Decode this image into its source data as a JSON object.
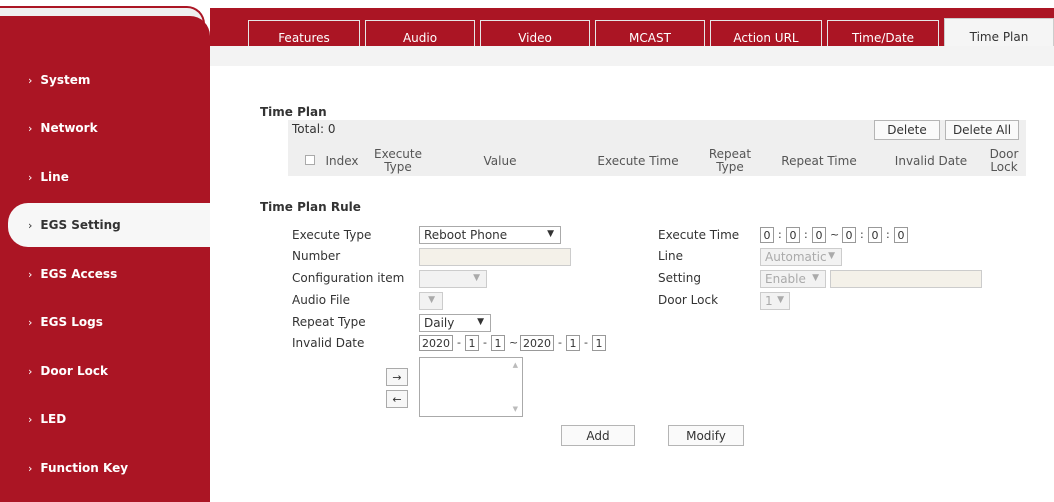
{
  "sidebar": {
    "items": [
      {
        "label": "System"
      },
      {
        "label": "Network"
      },
      {
        "label": "Line"
      },
      {
        "label": "EGS Setting"
      },
      {
        "label": "EGS Access"
      },
      {
        "label": "EGS Logs"
      },
      {
        "label": "Door Lock"
      },
      {
        "label": "LED"
      },
      {
        "label": "Function Key"
      }
    ],
    "chevron": "›"
  },
  "tabs": [
    {
      "label": "Features"
    },
    {
      "label": "Audio"
    },
    {
      "label": "Video"
    },
    {
      "label": "MCAST"
    },
    {
      "label": "Action URL"
    },
    {
      "label": "Time/Date"
    },
    {
      "label": "Time Plan"
    }
  ],
  "time_plan": {
    "title": "Time Plan",
    "total": "Total: 0",
    "delete_label": "Delete",
    "delete_all_label": "Delete All",
    "columns": [
      "Index",
      "Execute Type",
      "Value",
      "Execute Time",
      "Repeat Type",
      "Repeat Time",
      "Invalid Date",
      "Door Lock"
    ]
  },
  "rule": {
    "title": "Time Plan Rule",
    "execute_type_label": "Execute Type",
    "execute_type_value": "Reboot Phone",
    "number_label": "Number",
    "config_item_label": "Configuration item",
    "audio_file_label": "Audio File",
    "repeat_type_label": "Repeat Type",
    "repeat_type_value": "Daily",
    "invalid_date_label": "Invalid Date",
    "invalid_date": {
      "start_year": "2020",
      "start_month": "1",
      "start_day": "1",
      "end_year": "2020",
      "end_month": "1",
      "end_day": "1"
    },
    "execute_time_label": "Execute Time",
    "execute_time": {
      "h1": "0",
      "m1": "0",
      "s1": "0",
      "h2": "0",
      "m2": "0",
      "s2": "0"
    },
    "line_label": "Line",
    "line_value": "Automatic",
    "setting_label": "Setting",
    "setting_value": "Enable",
    "door_lock_label": "Door Lock",
    "door_lock_value": "1",
    "move_right": "→",
    "move_left": "←",
    "add_label": "Add",
    "modify_label": "Modify"
  },
  "colors": {
    "brand": "#ab1524",
    "panel": "#efefef"
  }
}
